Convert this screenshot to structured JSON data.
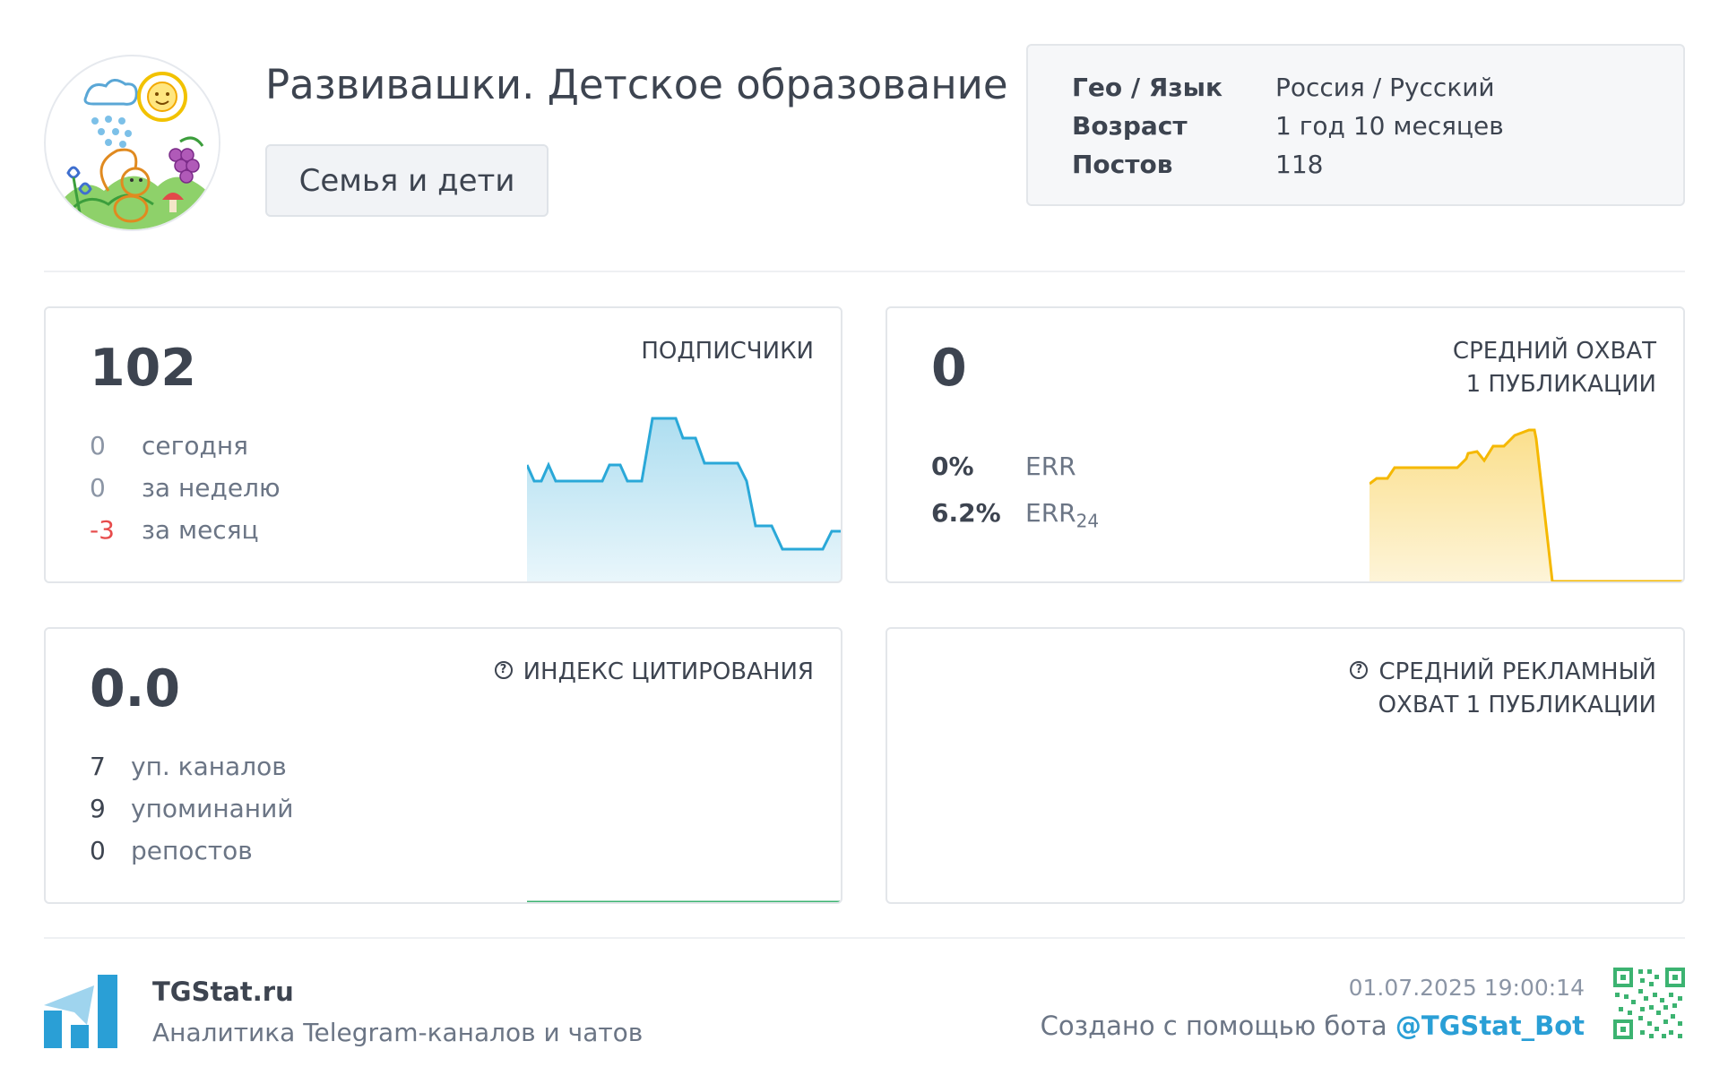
{
  "header": {
    "title": "Развивашки. Детское образование",
    "category": "Семья и дети",
    "info": [
      {
        "key": "Гео / Язык",
        "value": "Россия / Русский"
      },
      {
        "key": "Возраст",
        "value": "1 год 10 месяцев"
      },
      {
        "key": "Постов",
        "value": "118"
      }
    ]
  },
  "subscribers": {
    "value": "102",
    "label": "ПОДПИСЧИКИ",
    "stats": [
      {
        "num": "0",
        "text": "сегодня"
      },
      {
        "num": "0",
        "text": "за неделю"
      },
      {
        "num": "-3",
        "text": "за месяц"
      }
    ],
    "color": "#2aa8d8"
  },
  "reach": {
    "value": "0",
    "label_line1": "СРЕДНИЙ ОХВАТ",
    "label_line2": "1 ПУБЛИКАЦИИ",
    "err_value": "0%",
    "err_label": "ERR",
    "err24_value": "6.2%",
    "err24_label": "ERR",
    "err24_sub": "24",
    "color": "#f5b800"
  },
  "citation": {
    "value": "0.0",
    "label": "ИНДЕКС ЦИТИРОВАНИЯ",
    "stats": [
      {
        "num": "7",
        "text": "уп. каналов"
      },
      {
        "num": "9",
        "text": "упоминаний"
      },
      {
        "num": "0",
        "text": "репостов"
      }
    ],
    "color": "#3cb371"
  },
  "ad_reach": {
    "label_line1": "СРЕДНИЙ РЕКЛАМНЫЙ",
    "label_line2": "ОХВАТ 1 ПУБЛИКАЦИИ"
  },
  "footer": {
    "brand": "TGStat.ru",
    "tagline": "Аналитика Telegram-каналов и чатов",
    "timestamp": "01.07.2025 19:00:14",
    "created_text": "Создано с помощью бота",
    "bot": "@TGStat_Bot",
    "brand_color": "#2a9fd6"
  }
}
